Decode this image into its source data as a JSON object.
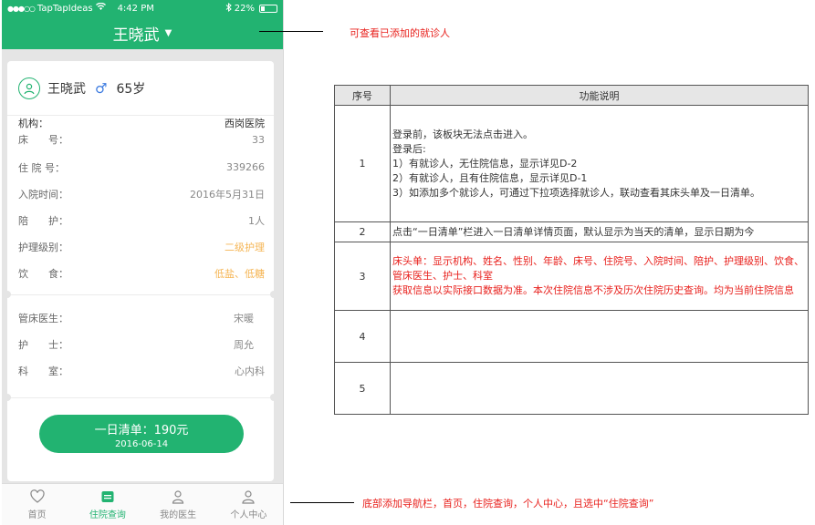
{
  "status_bar": {
    "carrier": "TapTapIdeas",
    "time": "4:42 PM",
    "battery": "22%"
  },
  "header": {
    "title": "王晓武"
  },
  "patient": {
    "name": "王晓武",
    "gender_symbol": "♂",
    "age": "65岁"
  },
  "info": {
    "institution_label": "机构：",
    "institution_value": "西岗医院",
    "bed_label": "床　　号：",
    "bed_value": "33",
    "admission_no_label": "住 院 号：",
    "admission_no_value": "339266",
    "admission_date_label": "入院时间：",
    "admission_date_value": "2016年5月31日",
    "escort_label": "陪　　护：",
    "escort_value": "1人",
    "care_level_label": "护理级别：",
    "care_level_value": "二级护理",
    "diet_label": "饮　　食：",
    "diet_value": "低盐、低糖"
  },
  "staff": {
    "doctor_label": "管床医生：",
    "doctor_value": "宋暖",
    "nurse_label": "护　　士：",
    "nurse_value": "周允",
    "dept_label": "科　　室：",
    "dept_value": "心内科"
  },
  "daily_button": {
    "label": "一日清单：190元",
    "date": "2016-06-14"
  },
  "tabbar": {
    "home": "首页",
    "hospital_query": "住院查询",
    "my_doctor": "我的医生",
    "profile": "个人中心"
  },
  "annotations": {
    "top": "可查看已添加的就诊人",
    "bottom": "底部添加导航栏，首页，住院查询，个人中心，且选中“住院查询”"
  },
  "spec_table": {
    "headers": [
      "序号",
      "功能说明"
    ],
    "rows": [
      {
        "num": "1",
        "lines": [
          "登录前，该板块无法点击进入。",
          "登录后:",
          "1）有就诊人，无住院信息，显示详见D-2",
          "2）有就诊人，且有住院信息，显示详见D-1",
          "3）如添加多个就诊人，可通过下拉项选择就诊人，联动查看其床头单及一日清单。"
        ]
      },
      {
        "num": "2",
        "text": "点击“一日清单”栏进入一日清单详情页面，默认显示为当天的清单，显示日期为今"
      },
      {
        "num": "3",
        "line1": "床头单：显示机构、姓名、性别、年龄、床号、住院号、入院时间、陪护、护理级别、饮食、管床医生、护士、科室",
        "line2": "获取信息以实际接口数据为准。本次住院信息不涉及历次住院历史查询。均为当前住院信息"
      },
      {
        "num": "4",
        "text": ""
      },
      {
        "num": "5",
        "text": ""
      }
    ]
  },
  "colors": {
    "brand_green": "#22b371",
    "orange": "#f5b554",
    "annotation_red": "#e8211d",
    "gender_blue": "#3c7be0"
  }
}
